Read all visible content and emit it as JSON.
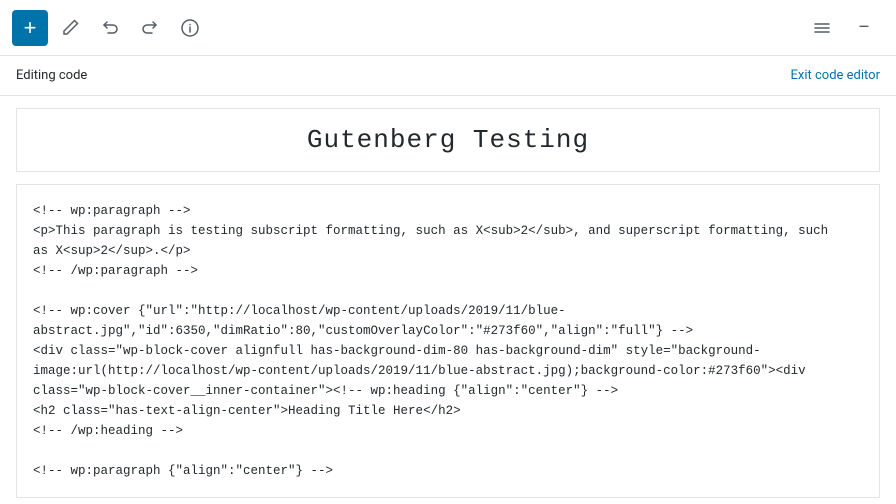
{
  "toolbar": {
    "add_label": "+",
    "undo_title": "Undo",
    "redo_title": "Redo",
    "info_title": "Block information",
    "menu_title": "More tools & options"
  },
  "editing_bar": {
    "label": "Editing code",
    "exit_link": "Exit code editor"
  },
  "title": "Gutenberg Testing",
  "code_content": "<!-- wp:paragraph -->\n<p>This paragraph is testing subscript formatting, such as X<sub>2</sub>, and superscript formatting, such\nas X<sup>2</sup>.</p>\n<!-- /wp:paragraph -->\n\n<!-- wp:cover {\"url\":\"http://localhost/wp-content/uploads/2019/11/blue-\nabstract.jpg\",\"id\":6350,\"dimRatio\":80,\"customOverlayColor\":\"#273f60\",\"align\":\"full\"} -->\n<div class=\"wp-block-cover alignfull has-background-dim-80 has-background-dim\" style=\"background-\nimage:url(http://localhost/wp-content/uploads/2019/11/blue-abstract.jpg);background-color:#273f60\"><div\nclass=\"wp-block-cover__inner-container\"><!-- wp:heading {\"align\":\"center\"} -->\n<h2 class=\"has-text-align-center\">Heading Title Here</h2>\n<!-- /wp:heading -->\n\n<!-- wp:paragraph {\"align\":\"center\"} -->"
}
